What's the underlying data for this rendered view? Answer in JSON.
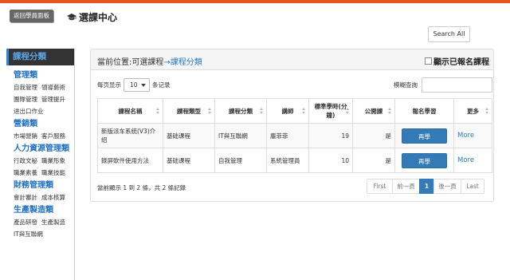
{
  "header": {
    "back_label": "返回學員面板",
    "title": "選課中心",
    "title_icon": "graduation-cap-icon",
    "search_all_label": "Search All"
  },
  "sidebar": {
    "heading": "課程分類",
    "categories": [
      {
        "name": "管理類",
        "items": [
          "自我管理",
          "領導藝術",
          "團隊管理",
          "管理提升",
          "进出口作业"
        ]
      },
      {
        "name": "營銷類",
        "items": [
          "市場營銷",
          "客戶服務"
        ]
      },
      {
        "name": "人力資源管理類",
        "items": [
          "行政文秘",
          "職業形象",
          "職業素養",
          "職業技能"
        ]
      },
      {
        "name": "財務管理類",
        "items": [
          "會計審計",
          "成本核算"
        ]
      },
      {
        "name": "生產製造類",
        "items": [
          "產品研發",
          "生產製造",
          "IT與互聯網"
        ]
      }
    ]
  },
  "panel": {
    "breadcrumb_prefix": "當前位置:可選課程",
    "breadcrumb_link": "→課程分類",
    "show_enrolled_label": "顯示已報名課程",
    "length_prefix": "每页显示",
    "length_value": "10",
    "length_suffix": "条记录",
    "filter_label": "模糊查詢",
    "columns": [
      "課程名稱",
      "課程類型",
      "課程分類",
      "講師",
      "標準學時(分鐘)",
      "公開課",
      "報名學習",
      "更多"
    ],
    "rows": [
      {
        "name": "新版派车系统(V3)介绍",
        "type": "基础课程",
        "category": "IT與互聯網",
        "teacher": "龐菲菲",
        "minutes": "19",
        "public": "是",
        "action": "再學",
        "more": "More"
      },
      {
        "name": "錄屏軟件使用方法",
        "type": "基础课程",
        "category": "自我管理",
        "teacher": "系統管理員",
        "minutes": "10",
        "public": "是",
        "action": "再學",
        "more": "More"
      }
    ],
    "info": "當前顯示 1 到 2 條，共 2 條記錄",
    "pager": {
      "first": "First",
      "prev": "前一頁",
      "current": "1",
      "next": "後一頁",
      "last": "Last"
    }
  },
  "colors": {
    "accent": "#e8541e",
    "primary": "#337ab7",
    "link": "#2a7bbf",
    "sidebar_bg": "#333333"
  }
}
